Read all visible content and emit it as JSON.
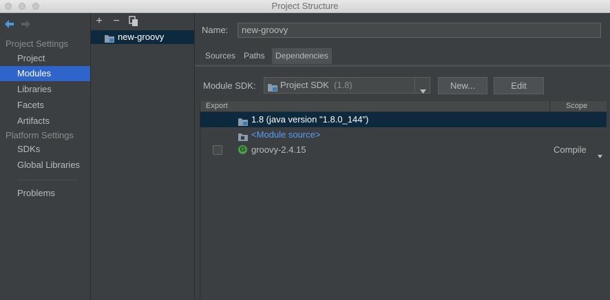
{
  "window": {
    "title": "Project Structure"
  },
  "leftnav": {
    "project_settings_header": "Project Settings",
    "platform_settings_header": "Platform Settings",
    "items": [
      {
        "label": "Project"
      },
      {
        "label": "Modules"
      },
      {
        "label": "Libraries"
      },
      {
        "label": "Facets"
      },
      {
        "label": "Artifacts"
      },
      {
        "label": "SDKs"
      },
      {
        "label": "Global Libraries"
      },
      {
        "label": "Problems"
      }
    ]
  },
  "middle": {
    "toolbar": {
      "add": "+",
      "remove": "−"
    },
    "module": "new-groovy"
  },
  "right": {
    "name_label": "Name:",
    "name_value": "new-groovy",
    "tabs": [
      "Sources",
      "Paths",
      "Dependencies"
    ],
    "sdk_label": "Module SDK:",
    "sdk_value": "Project SDK",
    "sdk_version": "(1.8)",
    "new_button": "New...",
    "edit_button": "Edit",
    "table": {
      "col_export": "Export",
      "col_scope": "Scope",
      "rows": [
        {
          "name": "1.8 (java version \"1.8.0_144\")"
        },
        {
          "name": "<Module source>"
        },
        {
          "name": "groovy-2.4.15",
          "scope": "Compile"
        }
      ]
    }
  },
  "colors": {
    "selection": "#2f65ca",
    "row_selection": "#0d293e",
    "link": "#589df6",
    "groovy_green": "#4a9c4a"
  }
}
